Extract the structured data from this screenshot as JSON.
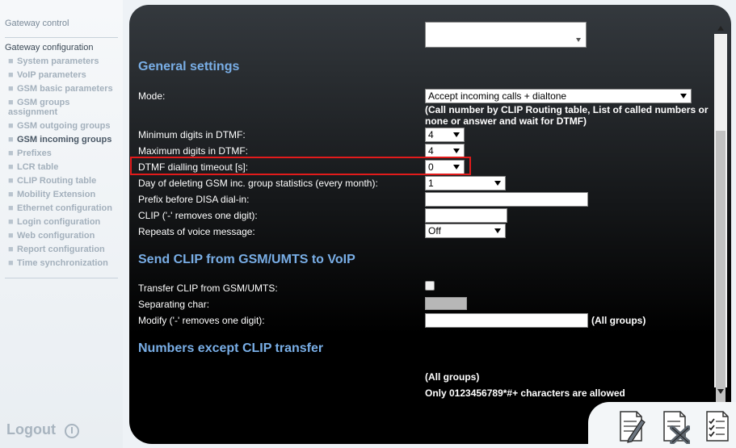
{
  "sidebar": {
    "gateway_control": "Gateway control",
    "gateway_configuration": "Gateway configuration",
    "items": [
      {
        "label": "System parameters"
      },
      {
        "label": "VoIP parameters"
      },
      {
        "label": "GSM basic parameters"
      },
      {
        "label": "GSM groups assignment"
      },
      {
        "label": "GSM outgoing groups"
      },
      {
        "label": "GSM incoming groups"
      },
      {
        "label": "Prefixes"
      },
      {
        "label": "LCR table"
      },
      {
        "label": "CLIP Routing table"
      },
      {
        "label": "Mobility Extension"
      },
      {
        "label": "Ethernet configuration"
      },
      {
        "label": "Login configuration"
      },
      {
        "label": "Web configuration"
      },
      {
        "label": "Report configuration"
      },
      {
        "label": "Time synchronization"
      }
    ],
    "bullet": "■",
    "logout": "Logout"
  },
  "general": {
    "title": "General settings",
    "mode_label": "Mode:",
    "mode_value": "Accept incoming calls + dialtone",
    "mode_note_line1": "(Call number by CLIP Routing table, List of called numbers or",
    "mode_note_line2": "none or answer and wait for DTMF)",
    "min_dtmf_label": "Minimum digits in DTMF:",
    "min_dtmf_value": "4",
    "max_dtmf_label": "Maximum digits in DTMF:",
    "max_dtmf_value": "4",
    "dtmf_timeout_label": "DTMF dialling timeout [s]:",
    "dtmf_timeout_value": "0",
    "day_delete_label": "Day of deleting GSM inc. group statistics (every month):",
    "day_delete_value": "1",
    "prefix_disa_label": "Prefix before DISA dial-in:",
    "prefix_disa_value": "",
    "clip_label": "CLIP ('-' removes one digit):",
    "clip_value": "",
    "repeats_label": "Repeats of voice message:",
    "repeats_value": "Off"
  },
  "send_clip": {
    "title": "Send CLIP from GSM/UMTS to VoIP",
    "transfer_label": "Transfer CLIP from GSM/UMTS:",
    "transfer_checked": false,
    "separating_label": "Separating char:",
    "modify_label": "Modify ('-' removes one digit):",
    "modify_value": "",
    "modify_note": "(All groups)"
  },
  "numbers_except": {
    "title": "Numbers except CLIP transfer",
    "all_groups": "(All groups)",
    "allowed_chars": "Only 0123456789*#+ characters are allowed"
  },
  "tray": {
    "buttons": [
      "edit-document-icon",
      "delete-document-icon",
      "checklist-document-icon"
    ]
  },
  "colors": {
    "section_title": "#79aee6",
    "highlight": "#e21b1b"
  }
}
